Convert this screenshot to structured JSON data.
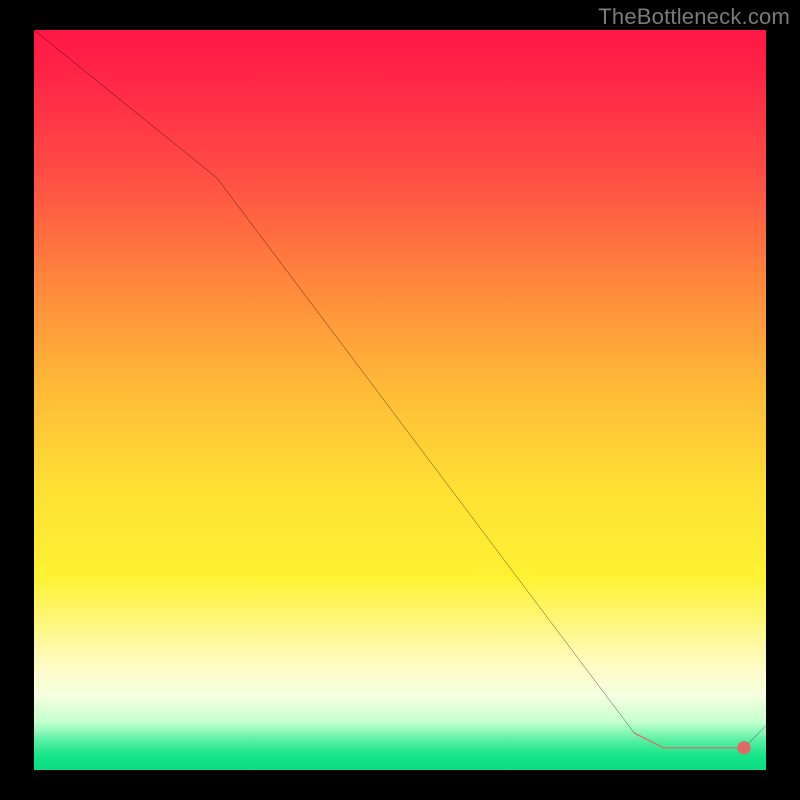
{
  "watermark": "TheBottleneck.com",
  "colors": {
    "line": "#000000",
    "marker_fill": "#de6a67",
    "marker_stroke": "#b04e4c",
    "background": "#000000"
  },
  "chart_data": {
    "type": "line",
    "title": "",
    "xlabel": "",
    "ylabel": "",
    "xlim": [
      0,
      100
    ],
    "ylim": [
      0,
      100
    ],
    "grid": false,
    "legend": false,
    "x": [
      0,
      25,
      82,
      86,
      93,
      97,
      100
    ],
    "values": [
      100,
      80,
      5,
      3,
      3,
      3,
      6
    ],
    "dashed_segment": {
      "x": [
        82,
        97
      ],
      "values": [
        5,
        3
      ]
    },
    "terminal_point": {
      "x": 97,
      "y": 3
    },
    "annotations": []
  }
}
